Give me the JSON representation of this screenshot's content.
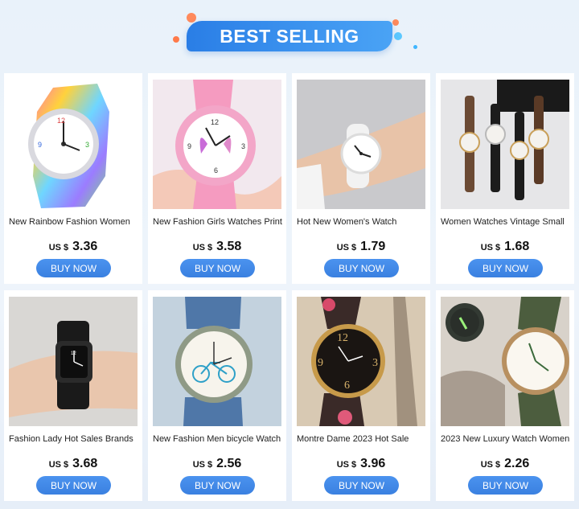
{
  "banner": {
    "title": "BEST SELLING"
  },
  "products": [
    {
      "title": "New Rainbow Fashion Women",
      "currency": "US $",
      "price": "3.36",
      "button": "BUY NOW",
      "image": "rainbow-silicone-watch"
    },
    {
      "title": "New Fashion Girls Watches Print",
      "currency": "US $",
      "price": "3.58",
      "button": "BUY NOW",
      "image": "pink-butterfly-watch"
    },
    {
      "title": "Hot New Women's Watch",
      "currency": "US $",
      "price": "1.79",
      "button": "BUY NOW",
      "image": "white-watch-on-wrist"
    },
    {
      "title": "Women Watches Vintage Small",
      "currency": "US $",
      "price": "1.68",
      "button": "BUY NOW",
      "image": "vintage-leather-watches"
    },
    {
      "title": "Fashion Lady Hot Sales Brands",
      "currency": "US $",
      "price": "3.68",
      "button": "BUY NOW",
      "image": "black-square-watch"
    },
    {
      "title": "New Fashion Men bicycle Watch",
      "currency": "US $",
      "price": "2.56",
      "button": "BUY NOW",
      "image": "bicycle-dial-denim-watch"
    },
    {
      "title": "Montre Dame 2023 Hot Sale",
      "currency": "US $",
      "price": "3.96",
      "button": "BUY NOW",
      "image": "floral-stretch-band-watch"
    },
    {
      "title": "2023 New Luxury Watch Women",
      "currency": "US $",
      "price": "2.26",
      "button": "BUY NOW",
      "image": "luminous-green-strap-watch"
    }
  ],
  "colors": {
    "accent": "#3a85e6",
    "banner": "#2a7ee6",
    "background": "#e9f2fa"
  }
}
